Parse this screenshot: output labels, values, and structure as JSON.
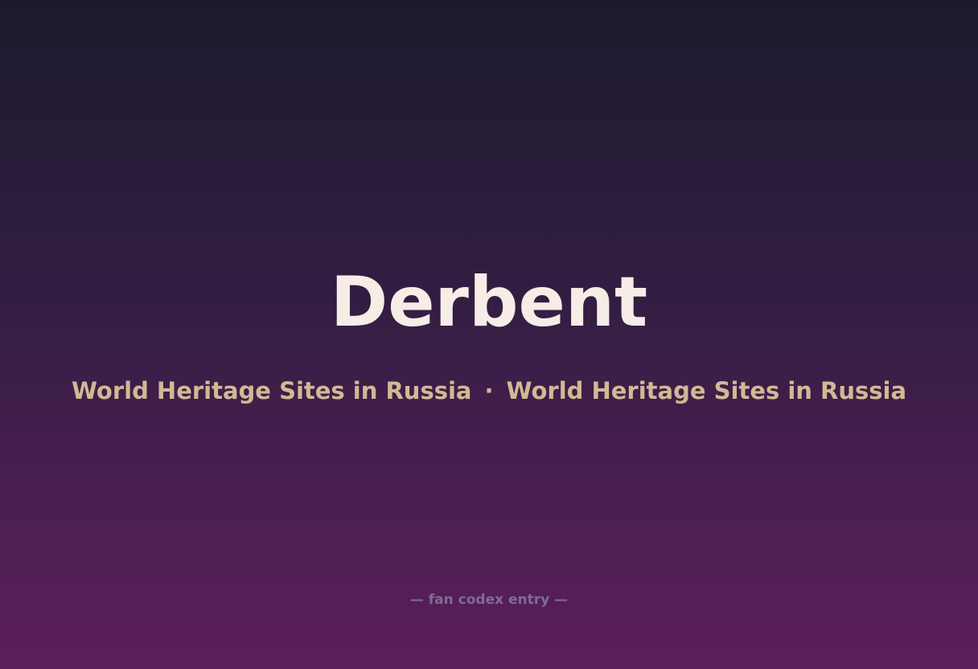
{
  "page": {
    "title": "Derbent",
    "subtitle_left": "World Heritage Sites in Russia",
    "subtitle_separator": "·",
    "subtitle_right": "World Heritage Sites in Russia",
    "footer": "— fan codex entry —"
  },
  "colors": {
    "background_top": "#1c1b2e",
    "background_bottom": "#5c1e5c",
    "title": "#f6ede6",
    "subtitle": "#d2b894",
    "footer": "#7b6e95"
  }
}
